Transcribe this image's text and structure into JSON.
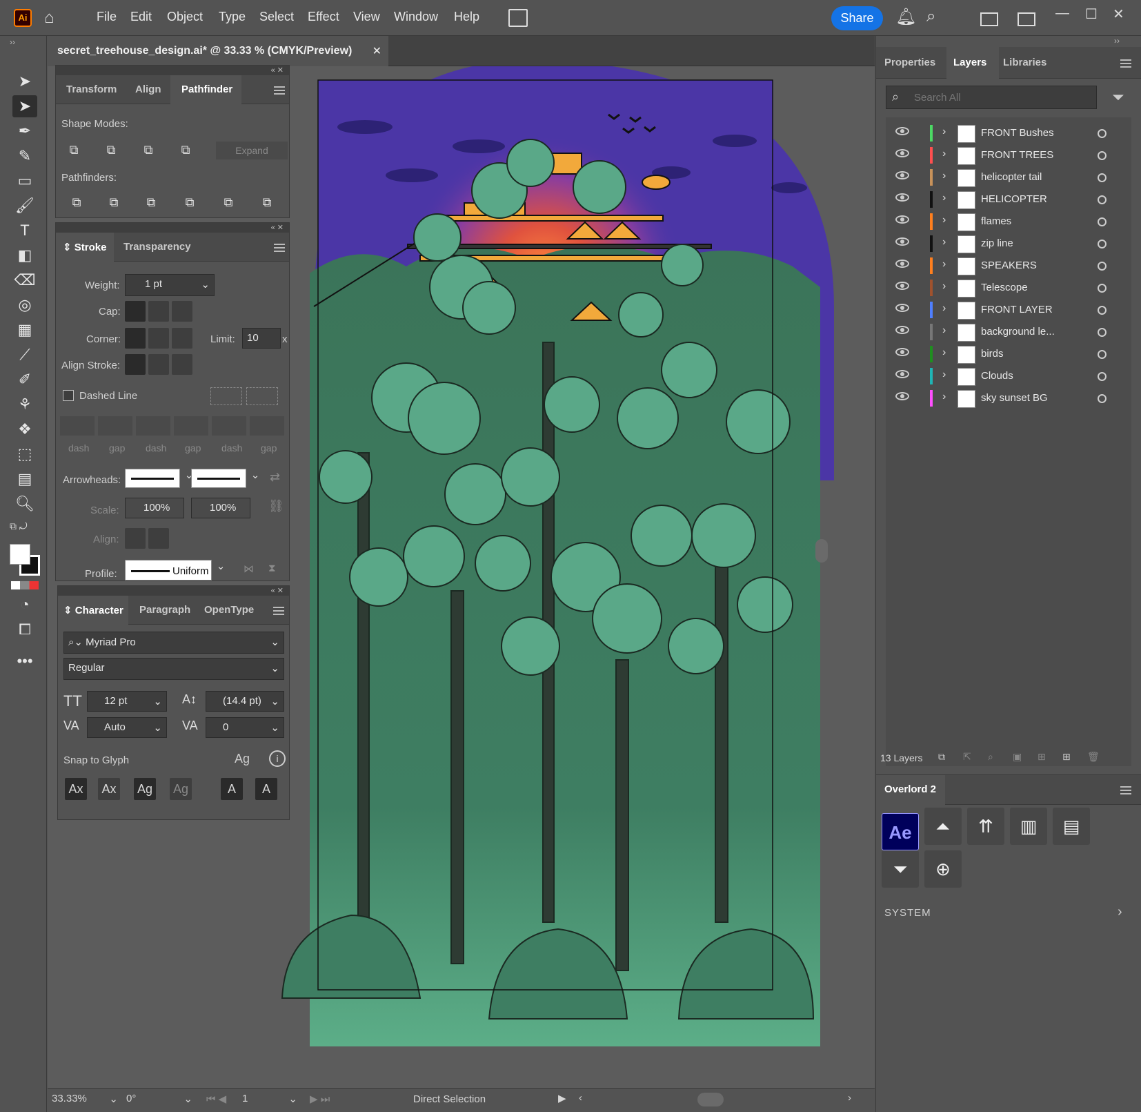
{
  "app": {
    "logo": "Ai",
    "menus": [
      "File",
      "Edit",
      "Object",
      "Type",
      "Select",
      "Effect",
      "View",
      "Window",
      "Help"
    ],
    "share_label": "Share"
  },
  "document": {
    "tab_title": "secret_treehouse_design.ai* @ 33.33 % (CMYK/Preview)",
    "close": "✕"
  },
  "pathfinder_panel": {
    "tabs": [
      "Transform",
      "Align",
      "Pathfinder"
    ],
    "shape_modes_label": "Shape Modes:",
    "expand_label": "Expand",
    "pathfinders_label": "Pathfinders:"
  },
  "stroke_panel": {
    "tabs": [
      "Stroke",
      "Transparency"
    ],
    "weight_label": "Weight:",
    "weight_value": "1 pt",
    "cap_label": "Cap:",
    "corner_label": "Corner:",
    "limit_label": "Limit:",
    "limit_value": "10",
    "limit_unit": "x",
    "align_stroke_label": "Align Stroke:",
    "dashed_line_label": "Dashed Line",
    "dash_labels": [
      "dash",
      "gap",
      "dash",
      "gap",
      "dash",
      "gap"
    ],
    "arrowheads_label": "Arrowheads:",
    "scale_label": "Scale:",
    "scale_values": [
      "100%",
      "100%"
    ],
    "align_label": "Align:",
    "profile_label": "Profile:",
    "profile_value": "Uniform"
  },
  "character_panel": {
    "tabs": [
      "Character",
      "Paragraph",
      "OpenType"
    ],
    "font_family": "Myriad Pro",
    "font_style": "Regular",
    "font_size": "12 pt",
    "leading": "(14.4 pt)",
    "kerning": "Auto",
    "tracking": "0",
    "snap_label": "Snap to Glyph"
  },
  "right_panel": {
    "tabs": [
      "Properties",
      "Layers",
      "Libraries"
    ],
    "search_placeholder": "Search All",
    "layers": [
      {
        "name": "FRONT Bushes",
        "color": "#4cd964"
      },
      {
        "name": "FRONT TREES",
        "color": "#ff4f4f"
      },
      {
        "name": "helicopter tail",
        "color": "#c8925a"
      },
      {
        "name": "HELICOPTER",
        "color": "#111111"
      },
      {
        "name": "flames",
        "color": "#ff7f1e"
      },
      {
        "name": "zip line",
        "color": "#111111"
      },
      {
        "name": "SPEAKERS",
        "color": "#ff7f1e"
      },
      {
        "name": "Telescope",
        "color": "#a0522d"
      },
      {
        "name": "FRONT LAYER",
        "color": "#4f7fff"
      },
      {
        "name": "background le...",
        "color": "#777777"
      },
      {
        "name": "birds",
        "color": "#1f8f1f"
      },
      {
        "name": "Clouds",
        "color": "#1fb5b5"
      },
      {
        "name": "sky sunset BG",
        "color": "#ff4fff"
      }
    ],
    "layers_count": "13 Layers",
    "overlord_title": "Overlord 2",
    "ae_label": "Ae",
    "system_label": "SYSTEM"
  },
  "status": {
    "zoom": "33.33%",
    "rotation": "0°",
    "artboard": "1",
    "tool": "Direct Selection"
  },
  "colors": {
    "sky": "#4b36a6",
    "forest": "#3f7d60",
    "leaf": "#5aa888",
    "trunk": "#2e3b33",
    "accent": "#1473e6"
  }
}
